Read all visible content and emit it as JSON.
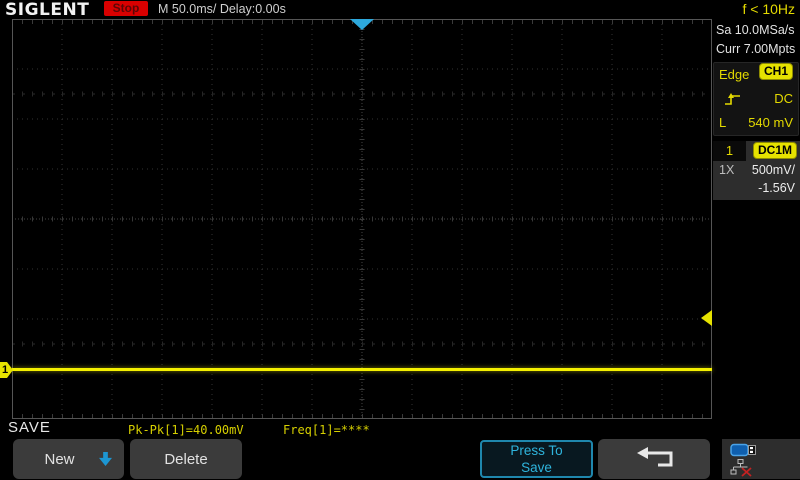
{
  "top_bar": {
    "brand": "SIGLENT",
    "run_state": "Stop",
    "timebase": "M 50.0ms/ Delay:0.00s",
    "trigger_frequency": "f < 10Hz"
  },
  "acquisition": {
    "sample_rate": "Sa 10.0MSa/s",
    "memory_depth": "Curr 7.00Mpts"
  },
  "trigger": {
    "type": "Edge",
    "source": "CH1",
    "slope": "rising",
    "coupling": "DC",
    "level_label": "L",
    "level": "540 mV"
  },
  "channel1": {
    "id": "1",
    "coupling": "DC1M",
    "attenuation": "1X",
    "volts_per_div": "500mV/",
    "offset": "-1.56V"
  },
  "waveform": {
    "channel_badge": "1",
    "shape": "flat line at channel ground level"
  },
  "measurements": {
    "pk_pk": "Pk-Pk[1]=40.00mV",
    "freq": "Freq[1]=****"
  },
  "menu": {
    "title": "SAVE",
    "new_button": "New",
    "delete_button": "Delete",
    "press_to_save_line1": "Press To",
    "press_to_save_line2": "Save"
  },
  "status_icons": {
    "usb": "usb-connected-icon",
    "lan": "lan-disconnected-icon"
  },
  "colors": {
    "accent_yellow": "#e6e200",
    "trace_yellow": "#f4f000",
    "accent_cyan": "#2fb4dc",
    "stop_red": "#d90000",
    "grid_gray": "#333333"
  }
}
